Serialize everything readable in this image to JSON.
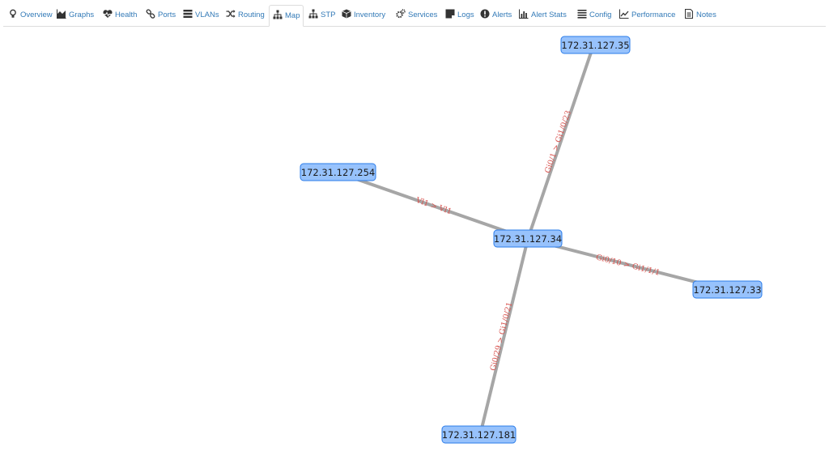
{
  "nav": {
    "tabs": [
      {
        "label": "Overview",
        "icon": "lightbulb-icon"
      },
      {
        "label": "Graphs",
        "icon": "area-chart-icon"
      },
      {
        "label": "Health",
        "icon": "heartbeat-icon"
      },
      {
        "label": "Ports",
        "icon": "link-icon"
      },
      {
        "label": "VLANs",
        "icon": "tasks-icon"
      },
      {
        "label": "Routing",
        "icon": "random-icon"
      },
      {
        "label": "Map",
        "icon": "sitemap-icon",
        "active": true
      },
      {
        "label": "STP",
        "icon": "sitemap-icon"
      },
      {
        "label": "Inventory",
        "icon": "cube-icon"
      },
      {
        "label": "Services",
        "icon": "cogs-icon"
      },
      {
        "label": "Logs",
        "icon": "sticky-note-icon"
      },
      {
        "label": "Alerts",
        "icon": "exclamation-circle-icon"
      },
      {
        "label": "Alert Stats",
        "icon": "bar-chart-icon"
      },
      {
        "label": "Config",
        "icon": "align-justify-icon"
      },
      {
        "label": "Performance",
        "icon": "line-chart-icon"
      },
      {
        "label": "Notes",
        "icon": "file-text-icon"
      }
    ]
  },
  "map": {
    "nodes": {
      "center": "172.31.127.34",
      "top": "172.31.127.35",
      "left": "172.31.127.254",
      "right": "172.31.127.33",
      "bottom": "172.31.127.181"
    },
    "edges": {
      "center_top": "Gi0/1 > Gi1/0/23",
      "center_left": "Vl1 > Vl1",
      "center_right": "Gi0/10 > Gi1/1/1",
      "center_bottom": "Gi0/29 > Gi1/0/21"
    },
    "colors": {
      "node_fill": "#97c2fc",
      "node_border": "#2b7ce9",
      "edge": "#a6a6a6",
      "edge_label": "#d9534f"
    }
  }
}
